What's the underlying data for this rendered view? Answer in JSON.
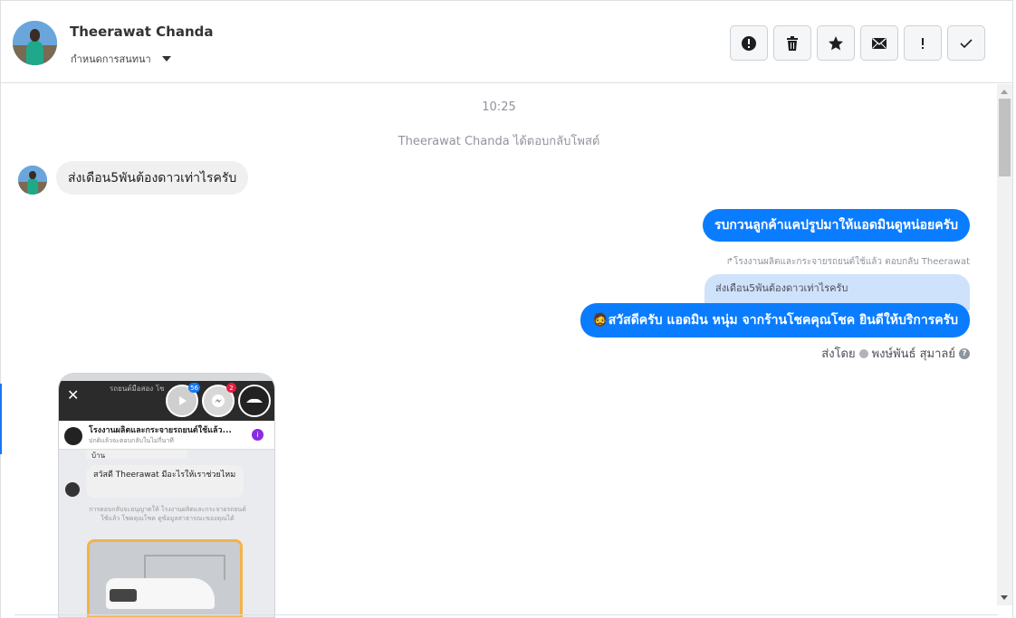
{
  "header": {
    "contact_name": "Theerawat Chanda",
    "assign_label": "กำหนดการสนทนา",
    "toolbar": [
      {
        "name": "spam-button",
        "icon": "alert-circle-icon"
      },
      {
        "name": "delete-button",
        "icon": "trash-icon"
      },
      {
        "name": "star-button",
        "icon": "star-icon"
      },
      {
        "name": "mark-unread-button",
        "icon": "envelope-icon"
      },
      {
        "name": "follow-up-button",
        "icon": "exclamation-icon"
      },
      {
        "name": "done-button",
        "icon": "checkmark-icon"
      }
    ]
  },
  "thread": {
    "time": "10:25",
    "replied_to_post": "Theerawat Chanda ได้ตอบกลับโพสต์",
    "incoming_message": "ส่งเดือน5พันต้องดาวเท่าไรครับ",
    "outgoing_message_1": "รบกวนลูกค้าแคปรูปมาให้แอดมินดูหน่อยครับ",
    "reply_note": "โรงงานผลิตและกระจายรถยนต์ใช้แล้ว ตอบกลับ Theerawat",
    "quoted_message": "ส่งเดือน5พันต้องดาวเท่าไรครับ",
    "outgoing_message_2": "🧔สวัสดีครับ แอดมิน หนุ่ม จากร้านโชคคุณโชค ยินดีให้บริการครับ",
    "sent_by_label": "ส่งโดย",
    "sent_by_name": "พงษ์พันธ์ สุมาลย์",
    "help_mark": "?"
  },
  "screenshot": {
    "title": "รถยนต์มือสอง โช",
    "badge_video": "56",
    "badge_messenger": "2",
    "page_name": "โรงงานผลิตและกระจายรถยนต์ใช้แล้ว...",
    "page_sub": "ปกติแล้วจะตอบกลับในไม่กี่นาที",
    "bubble_top": "บ้าน",
    "bubble_greeting": "สวัสดี Theerawat มีอะไรให้เราช่วยไหม",
    "note": "การตอบกลับจะอนุญาตให้ โรงงานผลิตและกระจายรถยนต์ใช้แล้ว โชคคุณโชค ดูข้อมูลสาธารณะของคุณได้",
    "info_icon": "i"
  },
  "colors": {
    "accent": "#0a7cff",
    "incoming_bubble": "#f0f0f0",
    "quoted_bubble": "#cfe2fb"
  }
}
